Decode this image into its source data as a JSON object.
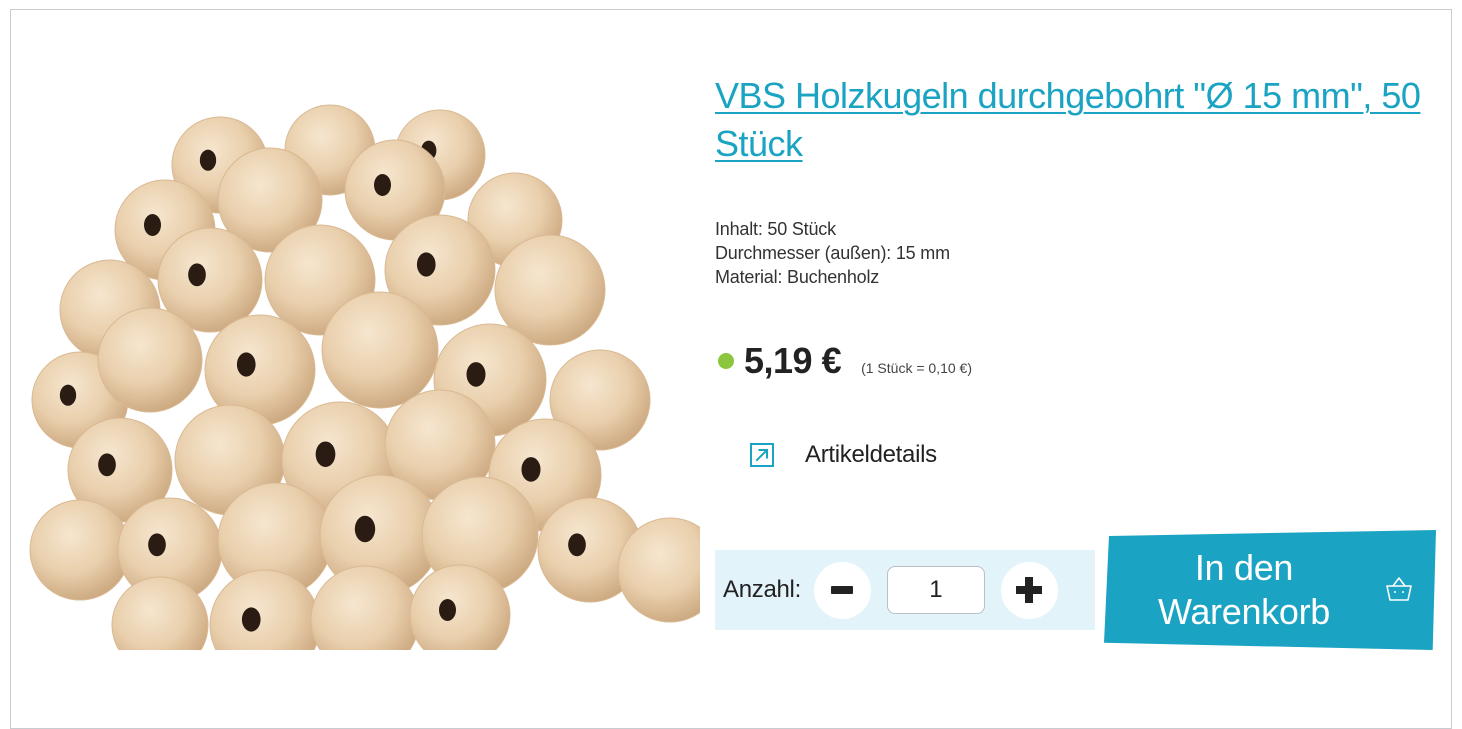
{
  "product": {
    "title": "VBS Holzkugeln durchgebohrt \"Ø 15 mm\", 50 Stück",
    "specs": [
      "Inhalt: 50 Stück",
      "Durchmesser (außen): 15 mm",
      "Material: Buchenholz"
    ],
    "price": "5,19 €",
    "unit_price": "(1 Stück = 0,10 €)",
    "stock_color": "#8cc63f"
  },
  "details_link": {
    "label": "Artikeldetails",
    "icon": "external-arrow-icon"
  },
  "quantity": {
    "label": "Anzahl:",
    "value": "1",
    "minus_icon": "minus-icon",
    "plus_icon": "plus-icon"
  },
  "cart_button": {
    "label_line1": "In den",
    "label_line2": "Warenkorb",
    "icon": "basket-icon"
  },
  "colors": {
    "accent": "#1aa3c2",
    "qty_background": "#e3f3fa",
    "stock": "#8cc63f"
  }
}
